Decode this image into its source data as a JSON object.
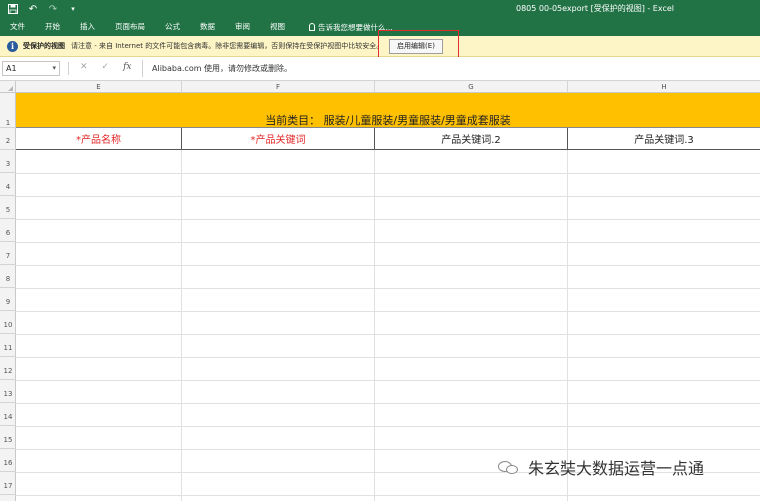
{
  "window": {
    "title": "0805 00-05export [受保护的视图] - Excel"
  },
  "quick_access": {
    "icons": [
      "save-icon",
      "undo-icon",
      "redo-icon",
      "customize-icon"
    ]
  },
  "ribbon": {
    "tabs": [
      "文件",
      "开始",
      "插入",
      "页面布局",
      "公式",
      "数据",
      "审阅",
      "视图"
    ],
    "tell_me": "告诉我您想要做什么..."
  },
  "protected_view": {
    "title": "受保护的视图",
    "message": "请注意 - 来自 Internet 的文件可能包含病毒。除非您需要编辑，否则保持在受保护视图中比较安全。",
    "enable_button": "启用编辑(E)",
    "highlight_color": "#e52b2b"
  },
  "formula_bar": {
    "name_box": "A1",
    "content": "Alibaba.com 使用，请勿修改或删除。"
  },
  "grid": {
    "columns": [
      "E",
      "F",
      "G",
      "H"
    ],
    "rows": [
      "1",
      "2",
      "3",
      "4",
      "5",
      "6",
      "7",
      "8",
      "9",
      "10",
      "11",
      "12",
      "13",
      "14",
      "15",
      "16",
      "17"
    ],
    "banner": "当前类目：  服装/儿童服装/男童服装/男童成套服装",
    "banner_color": "#ffc000",
    "headers": [
      {
        "text": "*产品名称",
        "required": true
      },
      {
        "text": "*产品关键词",
        "required": true
      },
      {
        "text": "产品关键词.2",
        "required": false
      },
      {
        "text": "产品关键词.3",
        "required": false
      }
    ]
  },
  "watermark": {
    "text": "朱玄奘大数据运营一点通"
  }
}
